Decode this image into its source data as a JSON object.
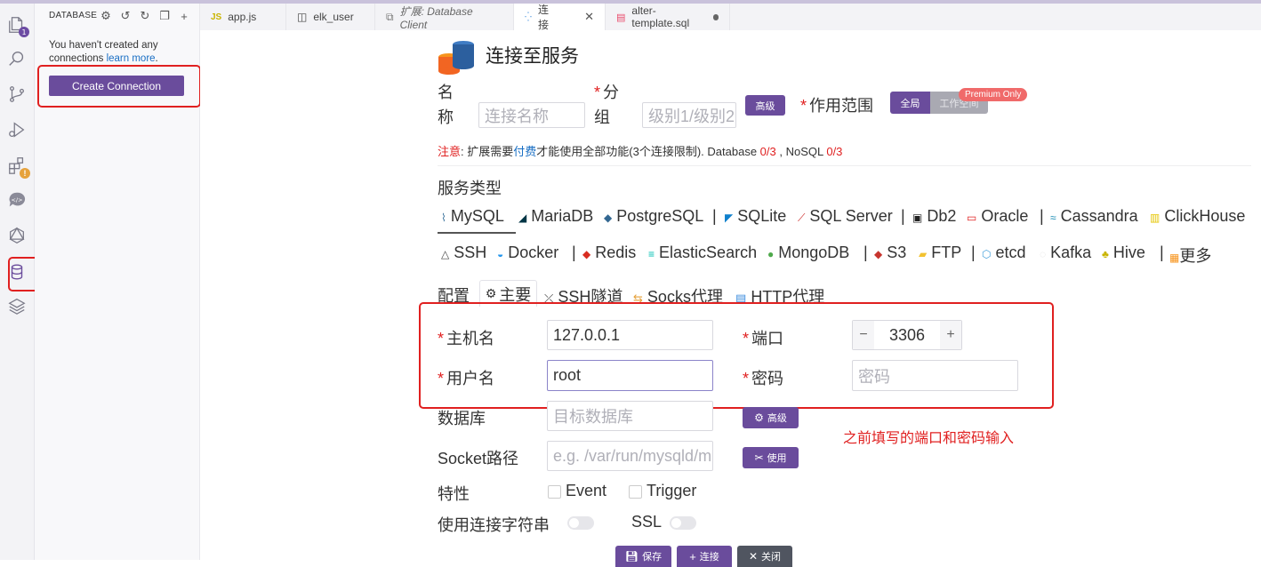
{
  "sidebar": {
    "header": "DATABASE",
    "message": "You haven't created any connections",
    "learn_more": "learn more",
    "message_end": ".",
    "create_button": "Create Connection"
  },
  "activity_bar": {
    "explorer_badge": "1",
    "icons": [
      "files-icon",
      "search-icon",
      "source-control-icon",
      "run-debug-icon",
      "extensions-icon",
      "api-icon",
      "graphql-icon",
      "database-icon",
      "layers-icon"
    ]
  },
  "tabs": [
    {
      "label": "app.js",
      "icon": "JS"
    },
    {
      "label": "elk_user",
      "icon": "panel-icon"
    },
    {
      "label": "扩展: Database Client",
      "icon": "extension-icon"
    },
    {
      "label": "连接",
      "icon": "connection-icon",
      "active": true
    },
    {
      "label": "alter-template.sql",
      "icon": "database-file-icon",
      "modified": true
    }
  ],
  "form": {
    "title": "连接至服务",
    "name_label_1": "名",
    "name_label_2": "称",
    "name_placeholder": "连接名称",
    "group_label_1": "分",
    "group_label_2": "组",
    "group_placeholder": "级别1/级别2",
    "advanced_btn": "高级",
    "scope_label": "作用范围",
    "scope_global": "全局",
    "scope_workspace": "工作空间",
    "premium_badge": "Premium Only",
    "notice_prefix": "注意",
    "notice_colon": ":",
    "notice_part1": " 扩展需要",
    "notice_paid": "付费",
    "notice_part2": "才能使用全部功能(3个连接限制). Database ",
    "notice_db_count": "0/3",
    "notice_part3": " , NoSQL ",
    "notice_nosql_count": "0/3",
    "service_type_label": "服务类型",
    "services_row1": [
      "MySQL",
      "MariaDB",
      "PostgreSQL",
      "SQLite",
      "SQL Server",
      "Db2",
      "Oracle",
      "Cassandra",
      "ClickHouse"
    ],
    "services_row2": [
      "SSH",
      "Docker",
      "Redis",
      "ElasticSearch",
      "MongoDB",
      "S3",
      "FTP",
      "etcd",
      "Kafka",
      "Hive",
      "更多"
    ],
    "separator": "|",
    "config_label": "配置",
    "config_tabs": [
      "主要",
      "SSH隧道",
      "Socks代理",
      "HTTP代理"
    ],
    "host_label": "主机名",
    "host_value": "127.0.0.1",
    "port_label": "端口",
    "port_value": "3306",
    "user_label": "用户名",
    "user_value": "root",
    "password_label": "密码",
    "password_placeholder": "密码",
    "database_label": "数据库",
    "database_placeholder": "目标数据库",
    "db_advanced_btn": "高级",
    "socket_label": "Socket路径",
    "socket_placeholder": "e.g. /var/run/mysqld/m",
    "use_btn": "使用",
    "feature_label": "特性",
    "event_label": "Event",
    "trigger_label": "Trigger",
    "conn_string_label": "使用连接字符串",
    "ssl_label": "SSL",
    "annotation": "之前填写的端口和密码输入",
    "required_mark": "*",
    "stepper_minus": "−",
    "stepper_plus": "+",
    "footer_save": "保存",
    "footer_connect": "连接",
    "footer_close": "关闭"
  },
  "colors": {
    "accent": "#6a4c9c",
    "required": "#e02020",
    "annotation_box": "#e02020",
    "link": "#1a6fc4"
  }
}
